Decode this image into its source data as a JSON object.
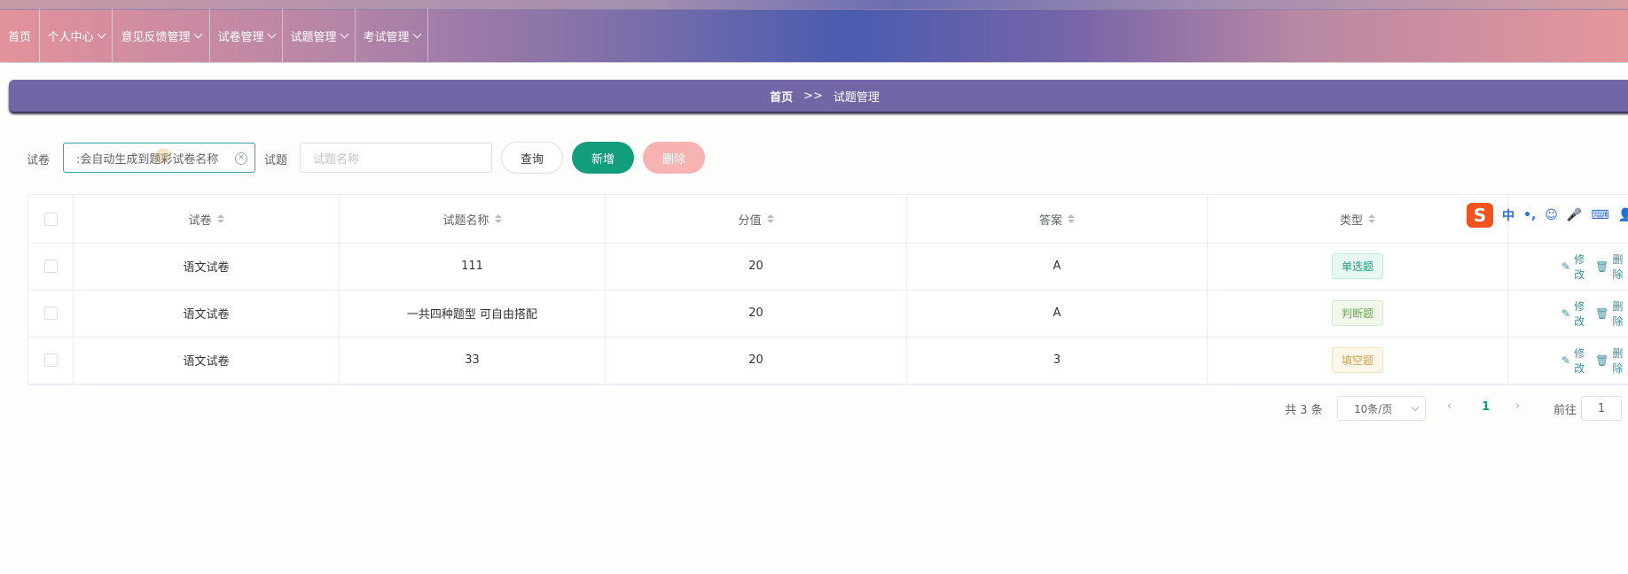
{
  "nav": {
    "home": "首页",
    "items": [
      {
        "label": "个人中心"
      },
      {
        "label": "意见反馈管理"
      },
      {
        "label": "试卷管理"
      },
      {
        "label": "试题管理"
      },
      {
        "label": "考试管理"
      }
    ]
  },
  "breadcrumb": {
    "home": "首页",
    "separator": ">>",
    "current": "试题管理"
  },
  "search": {
    "paper_label": "试卷",
    "paper_value": ":会自动生成到题彩试卷名称",
    "question_label": "试题",
    "question_placeholder": "试题名称",
    "query_button": "查询",
    "add_button": "新增",
    "delete_button": "删除"
  },
  "table": {
    "columns": [
      "试卷",
      "试题名称",
      "分值",
      "答案",
      "类型"
    ],
    "rows": [
      {
        "paper": "语文试卷",
        "name": "111",
        "score": "20",
        "answer": "A",
        "type": "单选题"
      },
      {
        "paper": "语文试卷",
        "name": "一共四种题型 可自由搭配",
        "score": "20",
        "answer": "A",
        "type": "判断题"
      },
      {
        "paper": "语文试卷",
        "name": "33",
        "score": "20",
        "answer": "3",
        "type": "填空题"
      }
    ],
    "edit_label": "修改",
    "delete_label": "删除"
  },
  "ime": {
    "logo": "S",
    "mode": "中",
    "punct": "•,"
  },
  "pagination": {
    "total": "共 3 条",
    "page_size": "10条/页",
    "current_page": "1",
    "goto_label": "前往",
    "goto_value": "1"
  },
  "colors": {
    "accent": "#129e7c",
    "breadcrumb_bg": "#7266a6",
    "delete_button": "#f6b3b1"
  }
}
